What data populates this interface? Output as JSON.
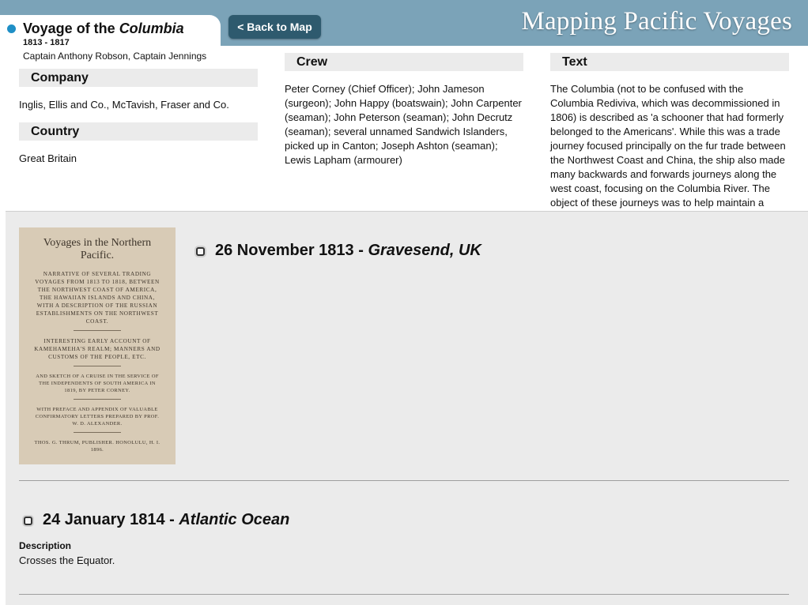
{
  "header": {
    "site_title": "Mapping Pacific Voyages",
    "back_label": "< Back to Map"
  },
  "voyage": {
    "title_prefix": "Voyage of the ",
    "ship": "Columbia",
    "years": "1813 - 1817",
    "captains": "Captain Anthony Robson, Captain Jennings"
  },
  "company": {
    "heading": "Company",
    "value": "Inglis, Ellis and Co., McTavish, Fraser and Co."
  },
  "country": {
    "heading": "Country",
    "value": "Great Britain"
  },
  "crew": {
    "heading": "Crew",
    "lines": [
      "Peter Corney (Chief Officer); John Jameson",
      "(surgeon); John Happy (boatswain); John Carpenter",
      "(seaman); John Peterson (seaman); John Decrutz",
      "(seaman); several unnamed Sandwich Islanders,",
      "picked up in Canton; Joseph Ashton (seaman);",
      "Lewis Lapham (armourer)"
    ]
  },
  "text": {
    "heading": "Text",
    "lines": [
      "The Columbia (not to be confused with the",
      "Columbia Rediviva, which was decommissioned in",
      "1806) is described as 'a schooner that had formerly",
      "belonged to the Americans'. While this was a trade",
      "journey focused principally on the fur trade between",
      "the Northwest Coast and China, the ship also made",
      "many backwards and forwards journeys along the",
      "west coast, focusing on the Columbia River. The",
      "object of these journeys was to help maintain a"
    ]
  },
  "book": {
    "title": "Voyages in the Northern Pacific.",
    "paragraph1": "NARRATIVE OF SEVERAL TRADING VOYAGES FROM 1813 TO 1818, BETWEEN THE NORTHWEST COAST OF AMERICA, THE HAWAIIAN ISLANDS AND CHINA, WITH A DESCRIPTION OF THE RUSSIAN ESTABLISHMENTS ON THE NORTHWEST COAST.",
    "paragraph2": "INTERESTING EARLY ACCOUNT OF KAMEHAMEHA'S REALM; MANNERS AND CUSTOMS OF THE PEOPLE, ETC.",
    "paragraph3": "AND SKETCH OF A CRUISE IN THE SERVICE OF THE INDEPENDENTS OF SOUTH AMERICA IN 1819, BY PETER CORNEY.",
    "paragraph4": "WITH PREFACE AND APPENDIX OF VALUABLE CONFIRMATORY LETTERS PREPARED BY PROF. W. D. ALEXANDER.",
    "publisher": "THOS. G. THRUM, PUBLISHER. HONOLULU, H. I. 1896."
  },
  "events": [
    {
      "date": "26 November 1813",
      "separator": " - ",
      "place": "Gravesend, UK"
    },
    {
      "date": "24 January 1814",
      "separator": " - ",
      "place": "Atlantic Ocean",
      "description_label": "Description",
      "description": "Crosses the Equator."
    }
  ]
}
